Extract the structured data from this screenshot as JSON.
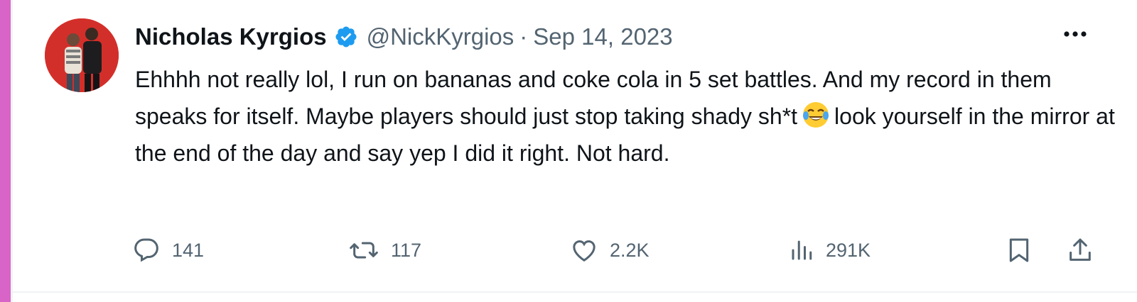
{
  "tweet": {
    "author_name": "Nicholas Kyrgios",
    "handle": "@NickKyrgios",
    "separator": "·",
    "date": "Sep 14, 2023",
    "text_part1": "Ehhhh not really lol, I run on bananas and coke cola in 5 set battles. And my record in them speaks for itself. Maybe players should just stop taking shady sh*t",
    "text_part2": "look yourself in the mirror at the end of the day and say yep I did it right. Not hard.",
    "emoji": "face-with-tears-of-joy"
  },
  "actions": {
    "replies": "141",
    "retweets": "117",
    "likes": "2.2K",
    "views": "291K"
  },
  "colors": {
    "accent_bar": "#d864c8",
    "verified": "#1d9bf0",
    "text": "#0f1419",
    "muted": "#536471"
  },
  "icons": [
    "verified-badge-icon",
    "more-icon",
    "reply-icon",
    "retweet-icon",
    "like-icon",
    "views-icon",
    "bookmark-icon",
    "share-icon"
  ]
}
